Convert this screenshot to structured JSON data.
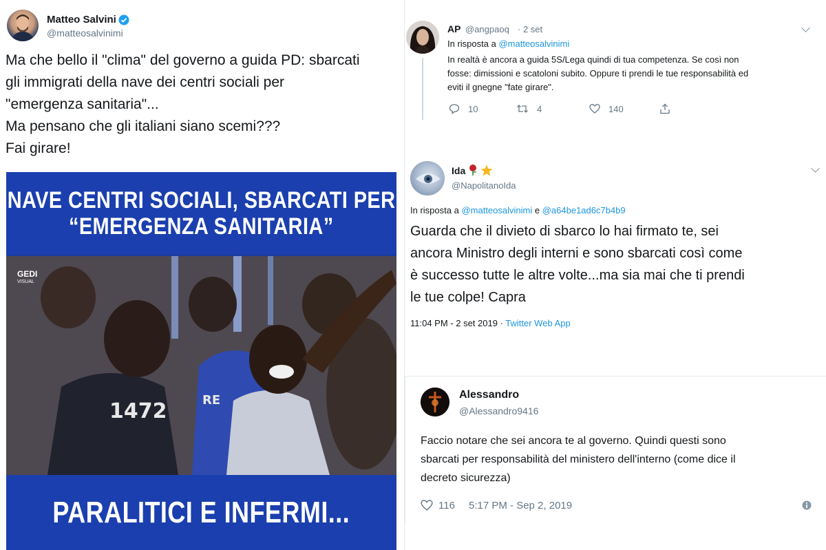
{
  "left_tweet": {
    "author": "Matteo Salvini",
    "handle": "@matteosalvinimi",
    "text_lines": [
      "Ma che bello il \"clima\" del governo a guida PD: sbarcati",
      "gli immigrati della nave dei centri sociali per",
      "\"emergenza sanitaria\"...",
      "Ma pensano che gli italiani siano scemi???",
      "Fai girare!"
    ],
    "media": {
      "headline_top_1": "NAVE CENTRI SOCIALI, SBARCATI PER",
      "headline_top_2": "“EMERGENZA SANITARIA”",
      "watermark": "GEDI",
      "watermark_sub": "VISUAL",
      "shirt_number": "1472",
      "headline_bottom": "PARALITICI E INFERMI..."
    }
  },
  "reply_ap": {
    "author": "AP",
    "handle": "@angpaoq",
    "date": "· 2 set",
    "reply_prefix": "In risposta a",
    "reply_to": "@matteosalvinimi",
    "text_lines": [
      "In realtà è ancora a guida 5S/Lega quindi di tua competenza. Se così non",
      "fosse: dimissioni e scatoloni subito. Oppure ti prendi le tue responsabilità ed",
      "eviti il gnegne \"fate girare\"."
    ],
    "replies": "10",
    "retweets": "4",
    "likes": "140"
  },
  "reply_ida": {
    "author": "Ida",
    "handle": "@NapolitanoIda",
    "reply_prefix": "In risposta a",
    "reply_to_1": "@matteosalvinimi",
    "reply_and": "e",
    "reply_to_2": "@a64be1ad6c7b4b9",
    "text_lines": [
      "Guarda che il divieto di sbarco lo hai firmato te, sei",
      "ancora Ministro degli interni  e sono sbarcati così come",
      "è successo tutte le altre volte...ma sia mai che ti prendi",
      "le tue colpe! Capra"
    ],
    "timestamp": "11:04 PM - 2 set 2019 ·",
    "source": "Twitter Web App"
  },
  "reply_alessandro": {
    "author": "Alessandro",
    "handle": "@Alessandro9416",
    "text_lines": [
      "Faccio notare che sei ancora te al governo. Quindi questi sono",
      "sbarcati per responsabilità del ministero dell'interno (come dice il",
      "decreto sicurezza)"
    ],
    "likes": "116",
    "timestamp": "5:17 PM - Sep 2, 2019"
  },
  "colors": {
    "link": "#1b95e0",
    "secondary_text": "#657786",
    "banner_blue": "#1b3fae",
    "verified": "#1da1f2"
  },
  "icons": [
    "verified-badge-icon",
    "chevron-down-icon",
    "reply-icon",
    "retweet-icon",
    "like-icon",
    "share-icon",
    "rose-emoji-icon",
    "star-emoji-icon",
    "info-icon"
  ]
}
